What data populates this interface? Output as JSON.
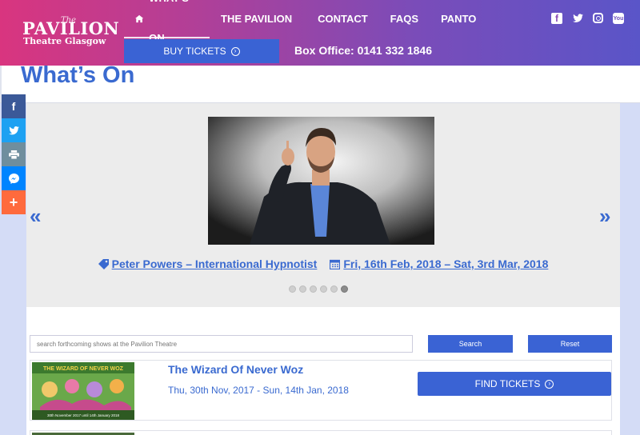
{
  "header": {
    "logo": {
      "the": "The",
      "main": "PAVILION",
      "sub": "Theatre Glasgow"
    },
    "nav": [
      {
        "label": "WHAT'S ON",
        "icon": "home-icon",
        "active": true
      },
      {
        "label": "THE PAVILION"
      },
      {
        "label": "CONTACT"
      },
      {
        "label": "FAQS"
      },
      {
        "label": "PANTO"
      }
    ],
    "social": [
      "facebook-icon",
      "twitter-icon",
      "instagram-icon",
      "youtube-icon"
    ],
    "buy_tickets_label": "BUY TICKETS",
    "box_office": "Box Office: 0141 332 1846"
  },
  "page": {
    "title": "What’s On"
  },
  "share_bar": [
    "facebook-icon",
    "twitter-icon",
    "print-icon",
    "messenger-icon",
    "add-icon"
  ],
  "carousel": {
    "show_title": "Peter Powers – International Hypnotist",
    "show_dates": "Fri, 16th Feb, 2018 – Sat, 3rd Mar, 2018",
    "dot_count": 6,
    "active_dot": 6
  },
  "search": {
    "placeholder": "search forthcoming shows at the Pavilion Theatre",
    "search_label": "Search",
    "reset_label": "Reset"
  },
  "listings": [
    {
      "title": "The Wizard Of Never Woz",
      "dates": "Thu, 30th Nov, 2017 - Sun, 14th Jan, 2018",
      "button_label": "FIND TICKETS",
      "poster_text": "30th November 2017 until 14th January 2018"
    }
  ],
  "colors": {
    "accent": "#3a63d4",
    "link": "#3a6ad0",
    "header_start": "#d9357f",
    "header_end": "#5a55c8"
  }
}
